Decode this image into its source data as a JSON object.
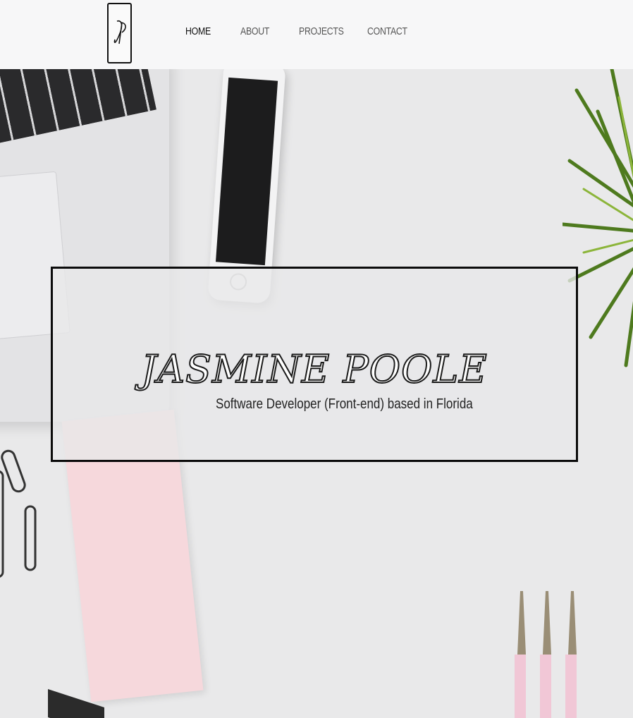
{
  "header": {
    "logo_text": "JP",
    "nav": [
      {
        "label": "HOME",
        "active": true
      },
      {
        "label": "ABOUT",
        "active": false
      },
      {
        "label": "PROJECTS",
        "active": false
      },
      {
        "label": "CONTACT",
        "active": false
      }
    ]
  },
  "intro": {
    "name": "JASMINE POOLE",
    "subtitle": "Software Developer (Front-end) based in Florida"
  },
  "colors": {
    "header_bg": "#f7f7f8",
    "border": "#0b0b0b",
    "sticky_note": "#f6d8dc",
    "plant": "#4e7a1e"
  },
  "icons": {
    "logo": "jp-monogram-icon"
  }
}
